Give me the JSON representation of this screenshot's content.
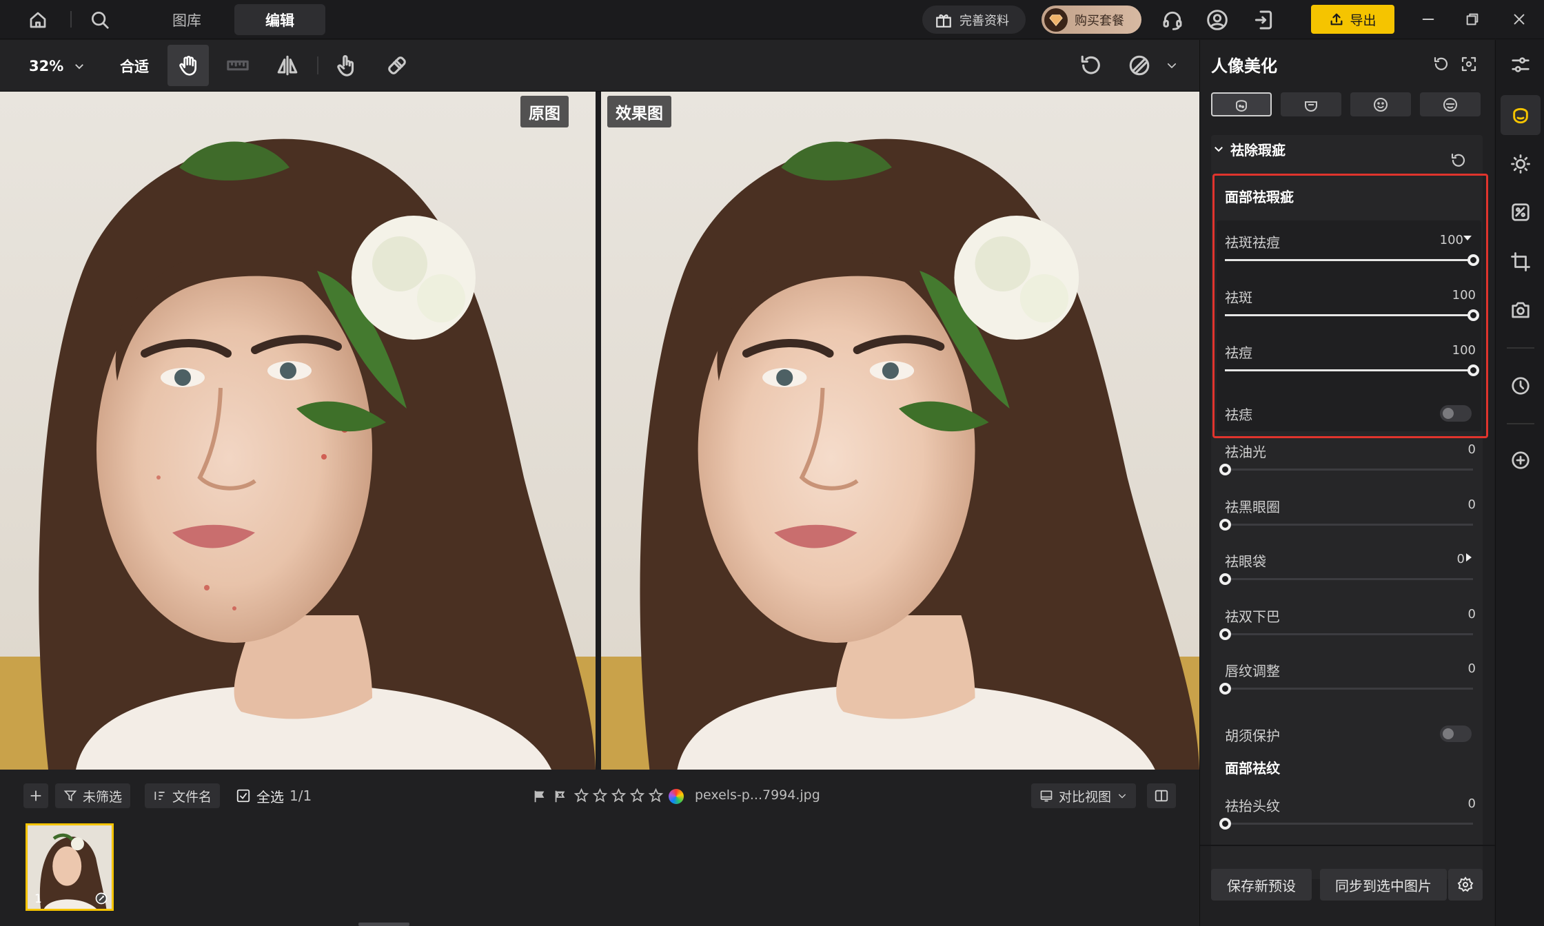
{
  "topbar": {
    "tabs": [
      {
        "label": "图库",
        "active": false
      },
      {
        "label": "编辑",
        "active": true
      }
    ],
    "complete_profile": "完善资料",
    "buy_package": "购买套餐",
    "export": "导出",
    "accent": "#f5c400"
  },
  "toolbar": {
    "zoom": "32%",
    "fit": "合适"
  },
  "canvas": {
    "original_label": "原图",
    "result_label": "效果图"
  },
  "filmbar": {
    "filter": "未筛选",
    "sort": "文件名",
    "select_all": "全选",
    "count": "1/1",
    "rating": 0,
    "filename": "pexels-p...7994.jpg",
    "view_mode": "对比视图",
    "thumb_index": "1"
  },
  "panel": {
    "title": "人像美化",
    "section": "祛除瑕疵",
    "group1": "面部祛瑕疵",
    "sliders": [
      {
        "label": "祛斑祛痘",
        "value": "100",
        "level": 1.0,
        "has_dropdown": true
      },
      {
        "label": "祛斑",
        "value": "100",
        "level": 1.0
      },
      {
        "label": "祛痘",
        "value": "100",
        "level": 1.0
      }
    ],
    "toggle_mole": "祛痣",
    "sliders2": [
      {
        "label": "祛油光",
        "value": "0",
        "level": 0
      },
      {
        "label": "祛黑眼圈",
        "value": "0",
        "level": 0
      },
      {
        "label": "祛眼袋",
        "value": "0",
        "level": 0,
        "has_arrow": true
      },
      {
        "label": "祛双下巴",
        "value": "0",
        "level": 0
      },
      {
        "label": "唇纹调整",
        "value": "0",
        "level": 0
      }
    ],
    "toggle_beard": "胡须保护",
    "group2": "面部祛纹",
    "sliders3": [
      {
        "label": "祛抬头纹",
        "value": "0",
        "level": 0
      }
    ],
    "save_preset": "保存新预设",
    "sync": "同步到选中图片"
  }
}
